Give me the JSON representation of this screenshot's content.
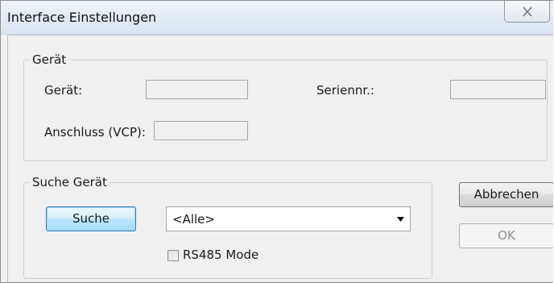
{
  "window": {
    "title": "Interface Einstellungen",
    "close_icon": "close-x-icon"
  },
  "device_group": {
    "label": "Gerät",
    "device_label": "Gerät:",
    "device_value": "",
    "serial_label": "Seriennr.:",
    "serial_value": "",
    "port_label": "Anschluss (VCP):",
    "port_value": ""
  },
  "search_group": {
    "label": "Suche Gerät",
    "search_button": "Suche",
    "filter_selected": "<Alle>",
    "rs485_label": "RS485 Mode",
    "rs485_checked": false
  },
  "buttons": {
    "cancel": "Abbrechen",
    "ok": "OK"
  }
}
